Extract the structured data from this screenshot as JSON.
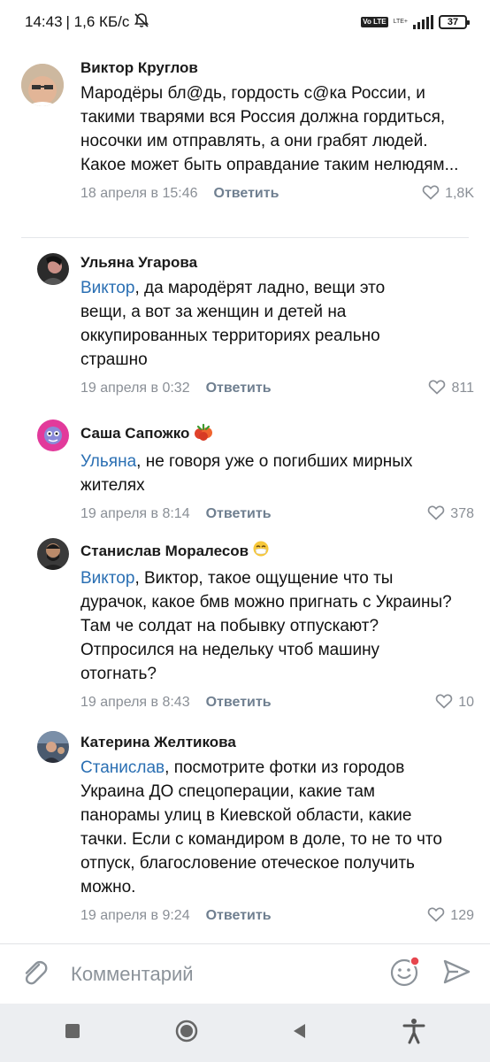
{
  "status_bar": {
    "time": "14:43",
    "network_speed": "| 1,6 КБ/с",
    "volte": "Vo LTE",
    "lte": "LTE+",
    "battery": "37"
  },
  "comments": [
    {
      "author": "Виктор Круглов",
      "mention": "",
      "text": "Мародёры бл@дь, гордость с@ка России, и такими тварями вся Россия должна гордиться, носочки им отправлять, а они грабят людей. Какое может быть оправдание таким нелюдям...",
      "date": "18 апреля в 15:46",
      "reply_label": "Ответить",
      "likes": "1,8K"
    },
    {
      "author": "Ульяна Угарова",
      "mention": "Виктор",
      "text": ", да мародёрят ладно, вещи это вещи, а вот за женщин и детей на оккупированных территориях реально страшно",
      "date": "19 апреля в 0:32",
      "reply_label": "Ответить",
      "likes": "811"
    },
    {
      "author": "Саша Сапожко",
      "mention": "Ульяна",
      "text": ", не говоря уже о погибших мирных жителях",
      "date": "19 апреля в 8:14",
      "reply_label": "Ответить",
      "likes": "378"
    },
    {
      "author": "Станислав Моралесов",
      "mention": "Виктор",
      "text": ", Виктор, такое ощущение что ты дурачок, какое бмв можно пригнать с Украины? Там че солдат на побывку отпускают? Отпросился на недельку чтоб машину отогнать?",
      "date": "19 апреля в 8:43",
      "reply_label": "Ответить",
      "likes": "10"
    },
    {
      "author": "Катерина Желтикова",
      "mention": "Станислав",
      "text": ", посмотрите фотки из городов Украина ДО спецоперации, какие там панорамы улиц в Киевской области, какие тачки. Если с командиром в доле, то не то что отпуск, благословение отеческое получить можно.",
      "date": "19 апреля в 9:24",
      "reply_label": "Ответить",
      "likes": "129"
    }
  ],
  "input": {
    "placeholder": "Комментарий"
  },
  "icons": {
    "attach": "paperclip-icon",
    "emoji": "smile-icon",
    "send": "send-icon",
    "nav": [
      "square-icon",
      "circle-icon",
      "back-icon",
      "accessibility-icon"
    ]
  },
  "colors": {
    "mention": "#2a6fb3",
    "meta": "#8a8f96",
    "nav_bg": "#eceef1"
  }
}
